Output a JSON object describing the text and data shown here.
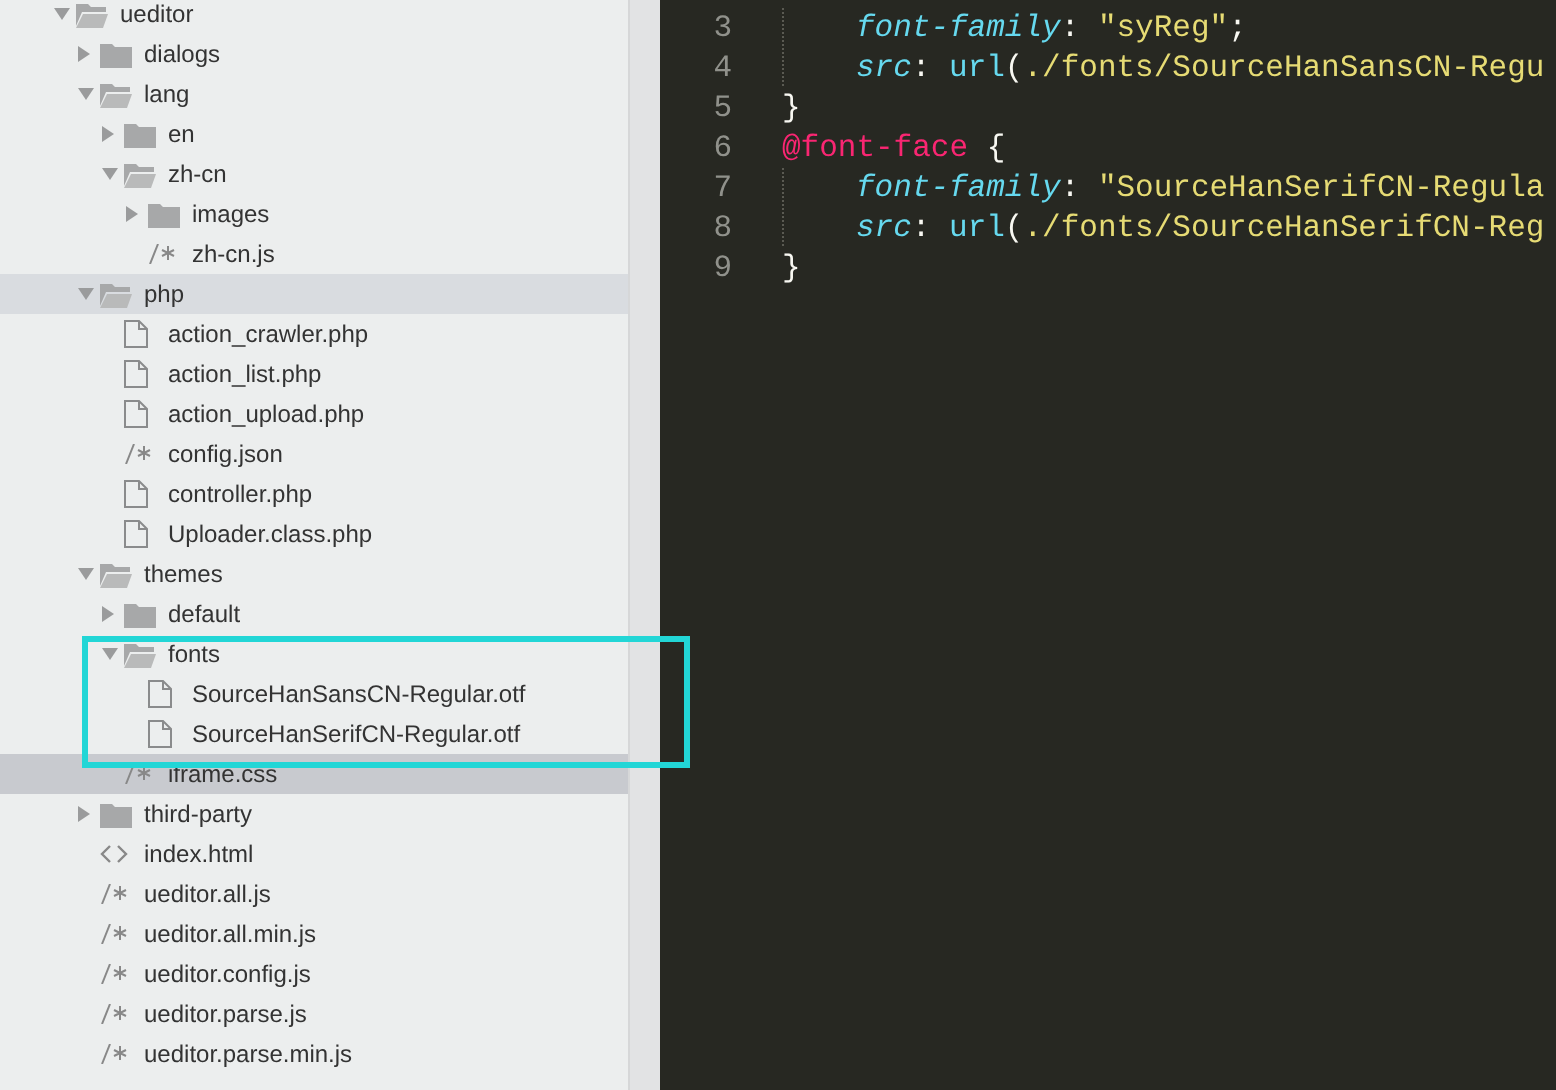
{
  "tree": [
    {
      "label": "ueditor",
      "kind": "folder",
      "expanded": true,
      "selected": false,
      "hovered": false,
      "children": [
        {
          "label": "dialogs",
          "kind": "folder",
          "expanded": false,
          "selected": false,
          "hovered": false
        },
        {
          "label": "lang",
          "kind": "folder",
          "expanded": true,
          "selected": false,
          "hovered": false,
          "children": [
            {
              "label": "en",
              "kind": "folder",
              "expanded": false,
              "selected": false,
              "hovered": false
            },
            {
              "label": "zh-cn",
              "kind": "folder",
              "expanded": true,
              "selected": false,
              "hovered": false,
              "children": [
                {
                  "label": "images",
                  "kind": "folder",
                  "expanded": false,
                  "selected": false,
                  "hovered": false
                },
                {
                  "label": "zh-cn.js",
                  "kind": "script",
                  "selected": false,
                  "hovered": false
                }
              ]
            }
          ]
        },
        {
          "label": "php",
          "kind": "folder",
          "expanded": true,
          "selected": false,
          "hovered": true,
          "children": [
            {
              "label": "action_crawler.php",
              "kind": "file",
              "selected": false,
              "hovered": false
            },
            {
              "label": "action_list.php",
              "kind": "file",
              "selected": false,
              "hovered": false
            },
            {
              "label": "action_upload.php",
              "kind": "file",
              "selected": false,
              "hovered": false
            },
            {
              "label": "config.json",
              "kind": "script",
              "selected": false,
              "hovered": false
            },
            {
              "label": "controller.php",
              "kind": "file",
              "selected": false,
              "hovered": false
            },
            {
              "label": "Uploader.class.php",
              "kind": "file",
              "selected": false,
              "hovered": false
            }
          ]
        },
        {
          "label": "themes",
          "kind": "folder",
          "expanded": true,
          "selected": false,
          "hovered": false,
          "children": [
            {
              "label": "default",
              "kind": "folder",
              "expanded": false,
              "selected": false,
              "hovered": false
            },
            {
              "label": "fonts",
              "kind": "folder",
              "expanded": true,
              "selected": false,
              "hovered": false,
              "children": [
                {
                  "label": "SourceHanSansCN-Regular.otf",
                  "kind": "file",
                  "selected": false,
                  "hovered": false
                },
                {
                  "label": "SourceHanSerifCN-Regular.otf",
                  "kind": "file",
                  "selected": false,
                  "hovered": false
                }
              ]
            },
            {
              "label": "iframe.css",
              "kind": "script",
              "selected": true,
              "hovered": false
            }
          ]
        },
        {
          "label": "third-party",
          "kind": "folder",
          "expanded": false,
          "selected": false,
          "hovered": false
        },
        {
          "label": "index.html",
          "kind": "markup",
          "selected": false,
          "hovered": false
        },
        {
          "label": "ueditor.all.js",
          "kind": "script",
          "selected": false,
          "hovered": false
        },
        {
          "label": "ueditor.all.min.js",
          "kind": "script",
          "selected": false,
          "hovered": false
        },
        {
          "label": "ueditor.config.js",
          "kind": "script",
          "selected": false,
          "hovered": false
        },
        {
          "label": "ueditor.parse.js",
          "kind": "script",
          "selected": false,
          "hovered": false
        },
        {
          "label": "ueditor.parse.min.js",
          "kind": "script",
          "selected": false,
          "hovered": false
        }
      ]
    }
  ],
  "editor": {
    "lines": [
      {
        "number": "3",
        "indented": true,
        "tokens": [
          {
            "kind": "property",
            "text": "font-family"
          },
          {
            "kind": "punct",
            "text": ": "
          },
          {
            "kind": "string",
            "text": "\"syReg\""
          },
          {
            "kind": "punct",
            "text": ";"
          }
        ]
      },
      {
        "number": "4",
        "indented": true,
        "tokens": [
          {
            "kind": "property",
            "text": "src"
          },
          {
            "kind": "punct",
            "text": ": "
          },
          {
            "kind": "function",
            "text": "url"
          },
          {
            "kind": "punct",
            "text": "("
          },
          {
            "kind": "string",
            "text": "./fonts/SourceHanSansCN-Regu"
          }
        ]
      },
      {
        "number": "5",
        "indented": false,
        "tokens": [
          {
            "kind": "punct",
            "text": "}"
          }
        ]
      },
      {
        "number": "6",
        "indented": false,
        "tokens": [
          {
            "kind": "atrule",
            "text": "@font-face"
          },
          {
            "kind": "punct",
            "text": " {"
          }
        ]
      },
      {
        "number": "7",
        "indented": true,
        "tokens": [
          {
            "kind": "property",
            "text": "font-family"
          },
          {
            "kind": "punct",
            "text": ": "
          },
          {
            "kind": "string",
            "text": "\"SourceHanSerifCN-Regula"
          }
        ]
      },
      {
        "number": "8",
        "indented": true,
        "tokens": [
          {
            "kind": "property",
            "text": "src"
          },
          {
            "kind": "punct",
            "text": ": "
          },
          {
            "kind": "function",
            "text": "url"
          },
          {
            "kind": "punct",
            "text": "("
          },
          {
            "kind": "string",
            "text": "./fonts/SourceHanSerifCN-Reg"
          }
        ]
      },
      {
        "number": "9",
        "indented": false,
        "tokens": [
          {
            "kind": "punct",
            "text": "}"
          }
        ]
      }
    ]
  }
}
